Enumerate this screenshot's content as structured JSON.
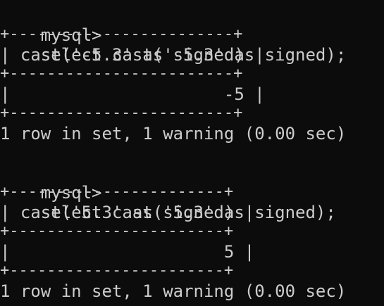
{
  "terminal": {
    "background": "#0c0c0c",
    "text_color": "#cccccc",
    "blocks": [
      {
        "prompt": "mysql>",
        "command": "select cast('-5.3' as signed);",
        "border": "+------------------------+",
        "header": "| cast('-5.3' as signed) |",
        "value_row": "|                     -5 |",
        "summary": "1 row in set, 1 warning (0.00 sec)"
      },
      {
        "prompt": "mysql>",
        "command": "select cast('5.3' as signed);",
        "border": "+-----------------------+",
        "header": "| cast('5.3' as signed) |",
        "value_row": "|                     5 |",
        "summary": "1 row in set, 1 warning (0.00 sec)"
      }
    ]
  }
}
